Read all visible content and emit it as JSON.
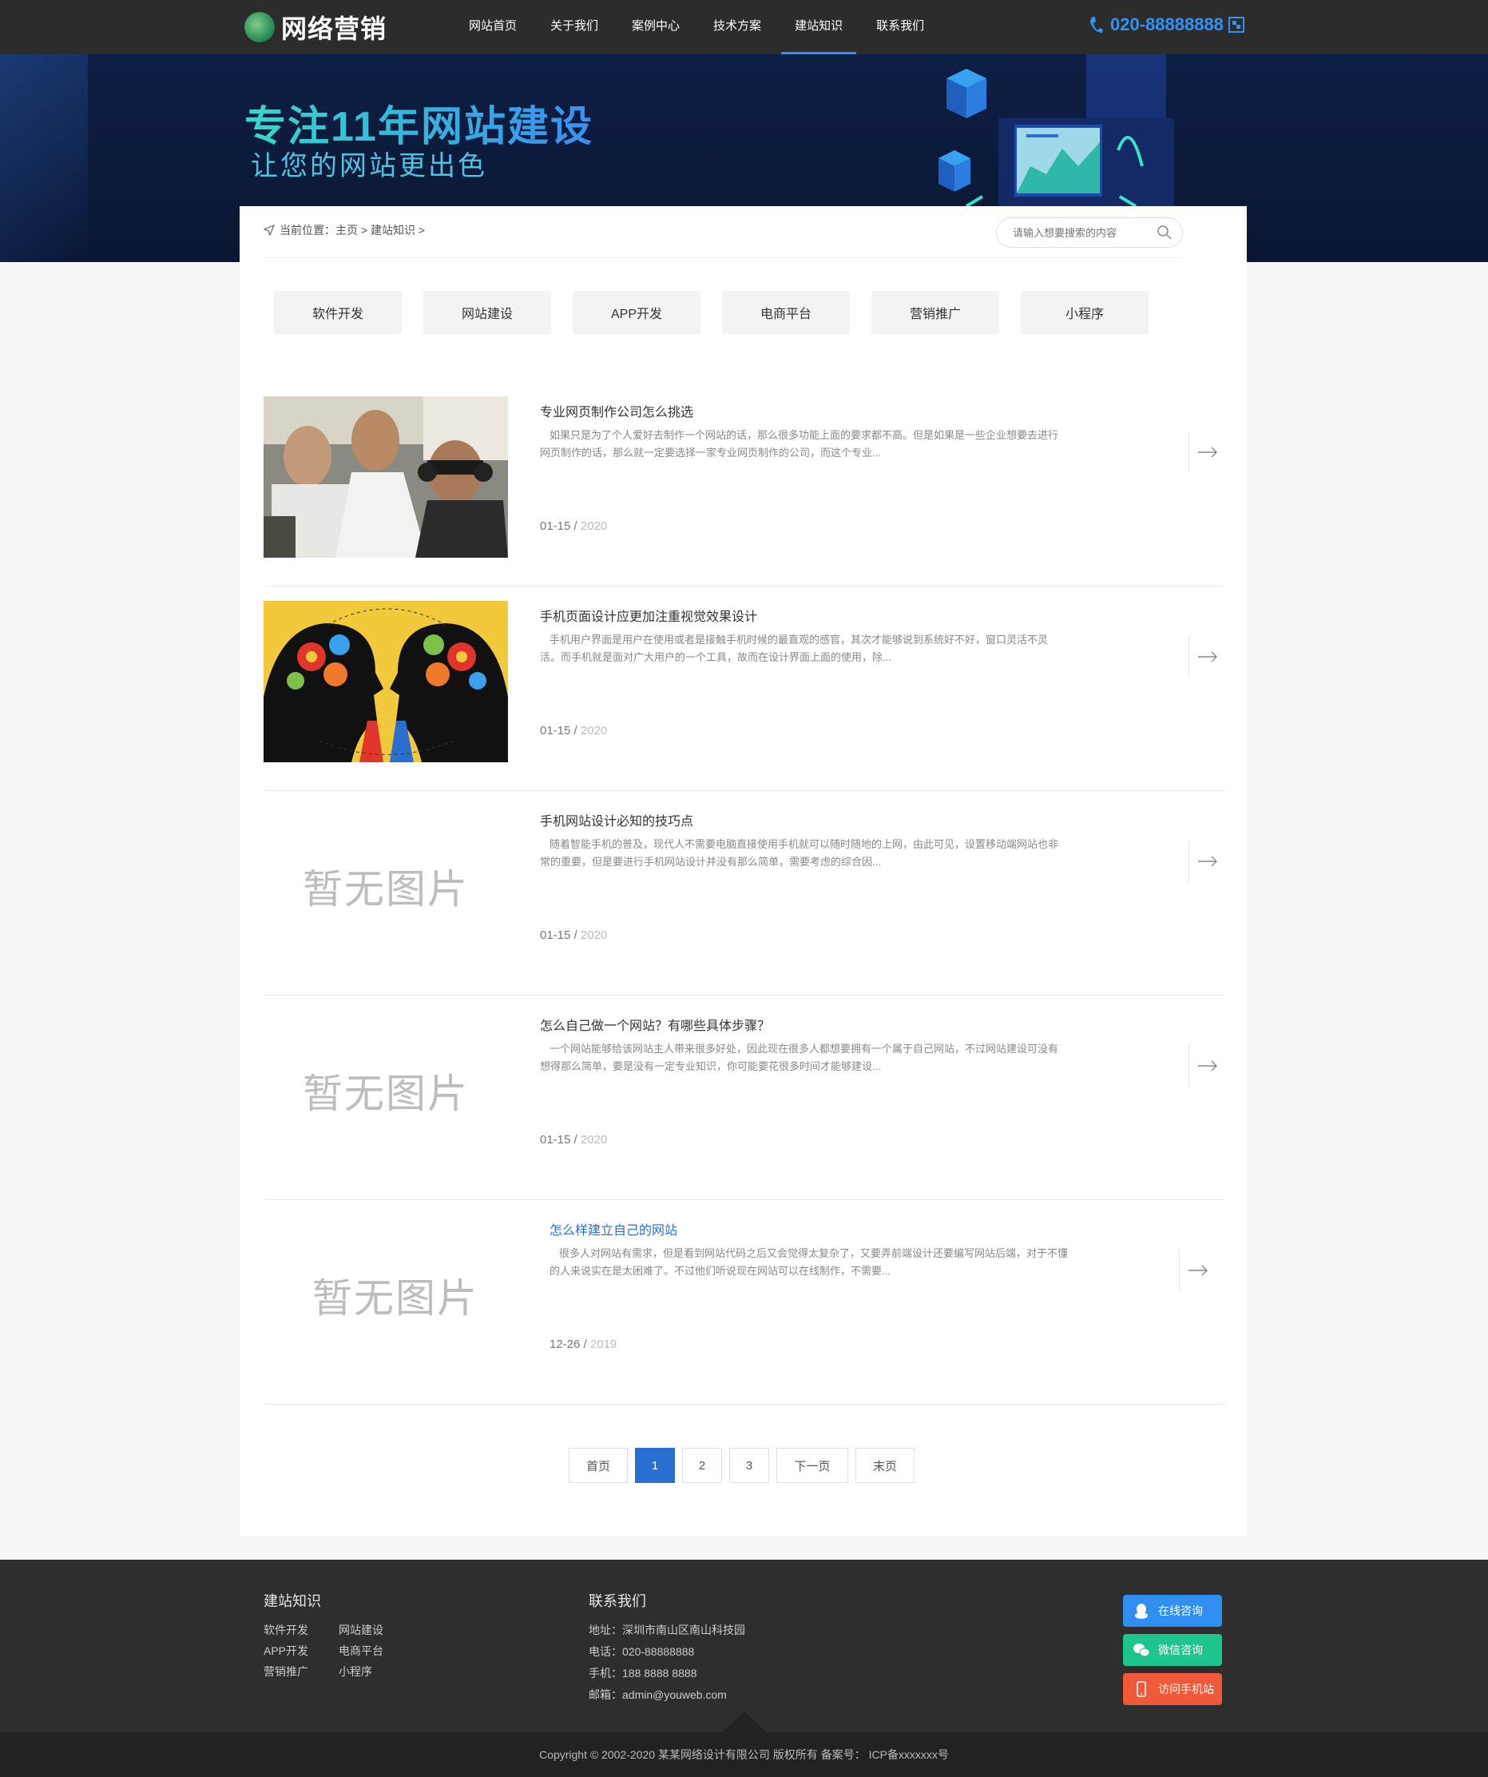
{
  "header": {
    "logo_text": "网络营销",
    "nav": [
      "网站首页",
      "关于我们",
      "案例中心",
      "技术方案",
      "建站知识",
      "联系我们"
    ],
    "active_nav": "建站知识",
    "phone": "020-88888888"
  },
  "banner": {
    "title": "专注11年网站建设",
    "subtitle": "让您的网站更出色"
  },
  "breadcrumb": {
    "prefix": "当前位置：",
    "trail": "主页 > 建站知识 >"
  },
  "search": {
    "placeholder": "请输入想要搜索的内容"
  },
  "categories": [
    "软件开发",
    "网站建设",
    "APP开发",
    "电商平台",
    "营销推广",
    "小程序"
  ],
  "articles": [
    {
      "title": "专业网页制作公司怎么挑选",
      "desc": "如果只是为了个人爱好去制作一个网站的话，那么很多功能上面的要求都不高。但是如果是一些企业想要去进行网页制作的话，那么就一定要选择一家专业网页制作的公司，而这个专业...",
      "date": "01-15",
      "year": "2020",
      "image": "photo-racers"
    },
    {
      "title": "手机页面设计应更加注重视觉效果设计",
      "desc": "手机用户界面是用户在使用或者是接触手机时候的最直观的感官，其次才能够说到系统好不好，窗口灵活不灵活。而手机就是面对广大用户的一个工具，故而在设计界面上面的使用，除...",
      "date": "01-15",
      "year": "2020",
      "image": "illustration-heads-gears"
    },
    {
      "title": "手机网站设计必知的技巧点",
      "desc": "随着智能手机的普及，现代人不需要电脑直接使用手机就可以随时随地的上网，由此可见，设置移动端网站也非常的重要，但是要进行手机网站设计并没有那么简单，需要考虑的综合因...",
      "date": "01-15",
      "year": "2020",
      "noimg": "暂无图片"
    },
    {
      "title": "怎么自己做一个网站？有哪些具体步骤？",
      "desc": "一个网站能够给该网站主人带来很多好处，因此现在很多人都想要拥有一个属于自己网站，不过网站建设可没有想得那么简单，要是没有一定专业知识，你可能要花很多时间才能够建设...",
      "date": "01-15",
      "year": "2020",
      "noimg": "暂无图片"
    },
    {
      "title": "怎么样建立自己的网站",
      "desc": "很多人对网站有需求，但是看到网站代码之后又会觉得太复杂了，又要弄前端设计还要编写网站后端，对于不懂的人来说实在是太困难了。不过他们听说现在网站可以在线制作，不需要...",
      "date": "12-26",
      "year": "2019",
      "noimg": "暂无图片",
      "highlighted": true
    }
  ],
  "pagination": [
    "首页",
    "1",
    "2",
    "3",
    "下一页",
    "末页"
  ],
  "pagination_active": "1",
  "footer": {
    "col1_title": "建站知识",
    "col1_links": [
      "软件开发",
      "网站建设",
      "APP开发",
      "电商平台",
      "营销推广",
      "小程序"
    ],
    "col2_title": "联系我们",
    "address": "地址：深圳市南山区南山科技园",
    "tel": "电话：020-88888888",
    "mobile": "手机：188 8888 8888",
    "email": "邮箱：admin@youweb.com",
    "btn_online": "在线咨询",
    "btn_wechat": "微信咨询",
    "btn_mobile": "访问手机站",
    "copyright": "Copyright © 2002-2020 某某网络设计有限公司 版权所有   备案号： ICP备xxxxxxx号"
  },
  "colors": {
    "primary": "#2a6fd0",
    "header_bg": "#2c2c2c",
    "banner_bg": "#0e1f45",
    "accent_cyan": "#33d9c9",
    "footer_bg": "#2e2e2e",
    "qq_btn": "#2f8ef0",
    "wechat_btn": "#1ec48e",
    "mobile_btn": "#f05a3a"
  }
}
